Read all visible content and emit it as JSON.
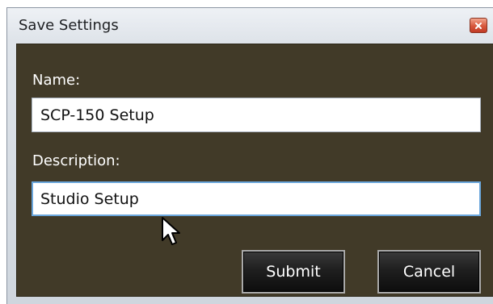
{
  "dialog": {
    "title": "Save Settings",
    "name_label": "Name:",
    "name_value": "SCP-150 Setup",
    "description_label": "Description:",
    "description_value": "Studio Setup",
    "submit_label": "Submit",
    "cancel_label": "Cancel"
  },
  "icons": {
    "close": "close-icon",
    "cursor": "mouse-pointer-icon"
  },
  "colors": {
    "content_background": "#413a28",
    "close_button": "#d7573c",
    "button_background": "#1f1f1f"
  }
}
